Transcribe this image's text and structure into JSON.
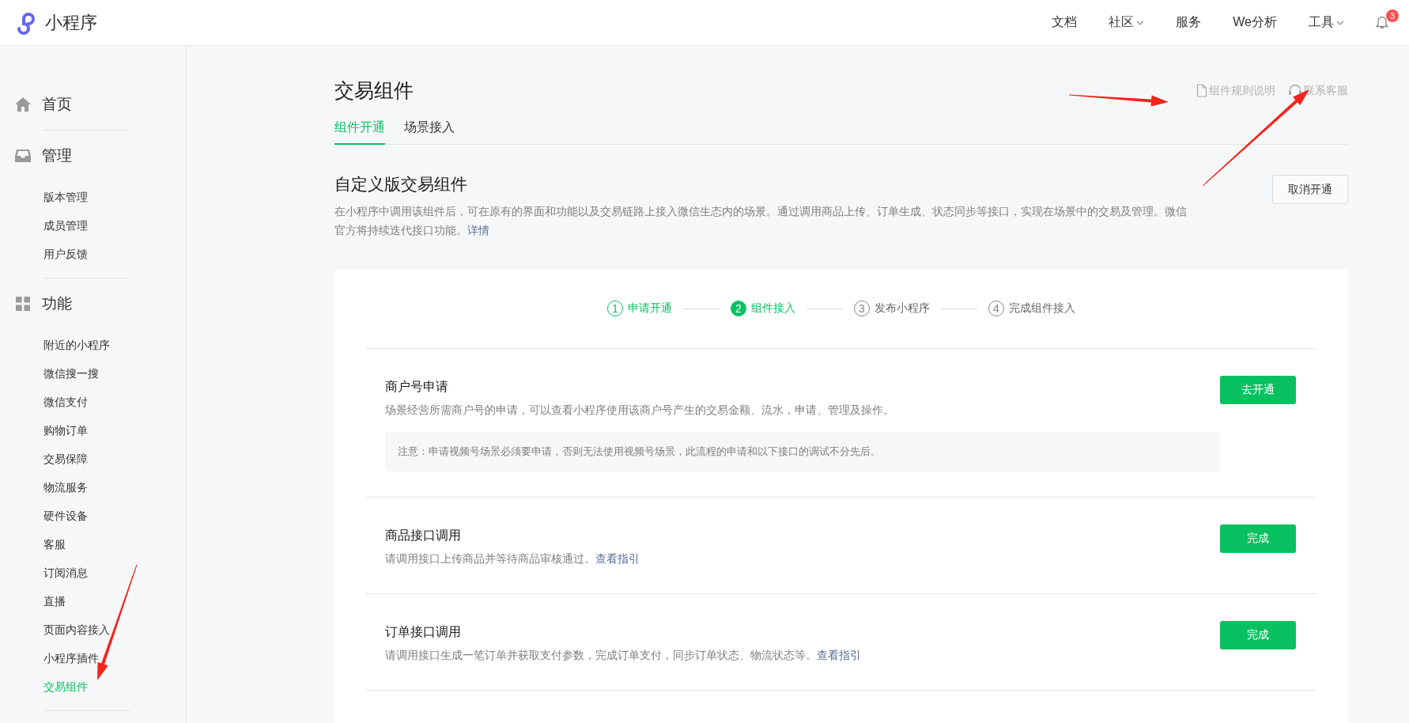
{
  "topbar": {
    "logo_text": "小程序",
    "nav": [
      {
        "label": "文档",
        "dropdown": false
      },
      {
        "label": "社区",
        "dropdown": true
      },
      {
        "label": "服务",
        "dropdown": false
      },
      {
        "label": "We分析",
        "dropdown": false
      },
      {
        "label": "工具",
        "dropdown": true
      }
    ],
    "notification_badge": "3"
  },
  "sidebar": {
    "groups": [
      {
        "title": "首页"
      },
      {
        "title": "管理",
        "items": [
          {
            "label": "版本管理",
            "selected": false
          },
          {
            "label": "成员管理",
            "selected": false
          },
          {
            "label": "用户反馈",
            "selected": false
          }
        ]
      },
      {
        "title": "功能",
        "items": [
          {
            "label": "附近的小程序",
            "selected": false
          },
          {
            "label": "微信搜一搜",
            "selected": false
          },
          {
            "label": "微信支付",
            "selected": false
          },
          {
            "label": "购物订单",
            "selected": false
          },
          {
            "label": "交易保障",
            "selected": false
          },
          {
            "label": "物流服务",
            "selected": false
          },
          {
            "label": "硬件设备",
            "selected": false
          },
          {
            "label": "客服",
            "selected": false
          },
          {
            "label": "订阅消息",
            "selected": false
          },
          {
            "label": "直播",
            "selected": false
          },
          {
            "label": "页面内容接入",
            "selected": false
          },
          {
            "label": "小程序插件",
            "selected": false
          },
          {
            "label": "交易组件",
            "selected": true
          }
        ]
      }
    ]
  },
  "page": {
    "title": "交易组件",
    "links": [
      {
        "label": "组件规则说明"
      },
      {
        "label": "联系客服"
      }
    ],
    "tabs": [
      {
        "label": "组件开通",
        "selected": true
      },
      {
        "label": "场景接入",
        "selected": false
      }
    ],
    "section": {
      "title": "自定义版交易组件",
      "description": "在小程序中调用该组件后，可在原有的界面和功能以及交易链路上接入微信生态内的场景。通过调用商品上传、订单生成、状态同步等接口，实现在场景中的交易及管理。微信官方将持续迭代接口功能。",
      "link": "详情",
      "button": "取消开通"
    },
    "steps": [
      {
        "number": "1",
        "label": "申请开通",
        "kind": "done"
      },
      {
        "number": "2",
        "label": "组件接入",
        "kind": "current"
      },
      {
        "number": "3",
        "label": "发布小程序",
        "kind": "todo"
      },
      {
        "number": "4",
        "label": "完成组件接入",
        "kind": "todo"
      }
    ],
    "tasks": [
      {
        "title": "商户号申请",
        "description": "场景经营所需商户号的申请，可以查看小程序使用该商户号产生的交易金额、流水，申请、管理及操作。",
        "button": "去开通",
        "note": "注意：申请视频号场景必须要申请，否则无法使用视频号场景，此流程的申请和以下接口的调试不分先后。"
      },
      {
        "title": "商品接口调用",
        "description": "请调用接口上传商品并等待商品审核通过。",
        "link": "查看指引",
        "button": "完成"
      },
      {
        "title": "订单接口调用",
        "description": "请调用接口生成一笔订单并获取支付参数，完成订单支付，同步订单状态、物流状态等。",
        "link": "查看指引",
        "button": "完成"
      }
    ]
  }
}
